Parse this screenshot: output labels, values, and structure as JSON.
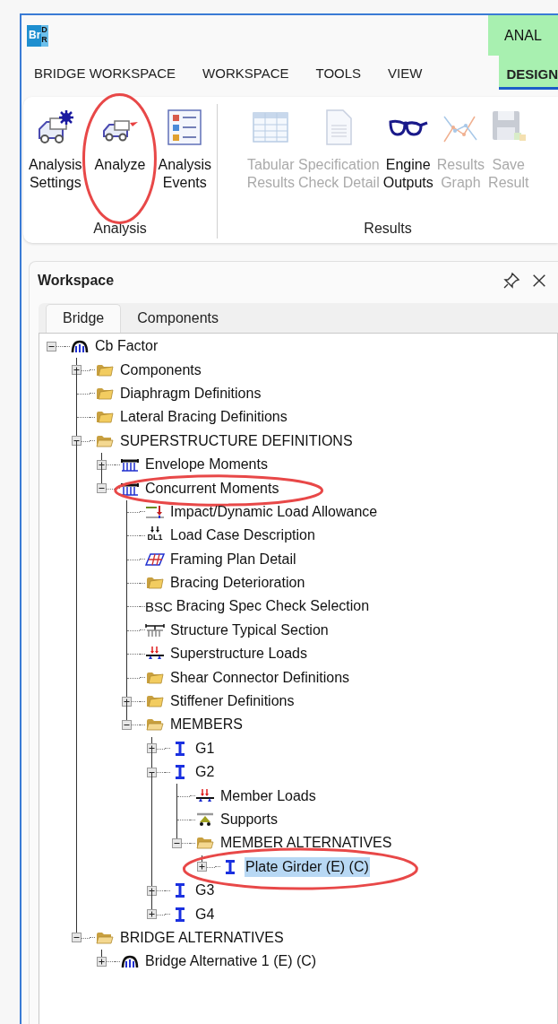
{
  "app": {
    "logo": [
      "Br",
      "DR"
    ],
    "context_tab": "ANAL"
  },
  "menu": [
    {
      "label": "BRIDGE WORKSPACE",
      "selected": false
    },
    {
      "label": "WORKSPACE",
      "selected": false
    },
    {
      "label": "TOOLS",
      "selected": false
    },
    {
      "label": "VIEW",
      "selected": false
    },
    {
      "label": "DESIGN",
      "selected": true
    }
  ],
  "ribbon": [
    {
      "label": "Analysis",
      "buttons": [
        {
          "kind": "settings",
          "lines": [
            "Analysis",
            "Settings"
          ],
          "disabled": false,
          "circled": false
        },
        {
          "kind": "analyze",
          "lines": [
            "Analyze"
          ],
          "disabled": false,
          "circled": true
        },
        {
          "kind": "events",
          "lines": [
            "Analysis",
            "Events"
          ],
          "disabled": false,
          "circled": false
        }
      ]
    },
    {
      "label": "Results",
      "buttons": [
        {
          "kind": "table",
          "lines": [
            "Tabular",
            "Results"
          ],
          "disabled": true,
          "circled": false
        },
        {
          "kind": "document",
          "lines": [
            "Specification",
            "Check Detail"
          ],
          "disabled": true,
          "circled": false
        },
        {
          "kind": "glasses",
          "lines": [
            "Engine",
            "Outputs"
          ],
          "disabled": false,
          "circled": false
        },
        {
          "kind": "graph",
          "lines": [
            "Results",
            "Graph"
          ],
          "disabled": true,
          "circled": false
        },
        {
          "kind": "save",
          "lines": [
            "Save",
            "Result"
          ],
          "disabled": true,
          "circled": false
        }
      ]
    }
  ],
  "workspace": {
    "title": "Workspace",
    "tabs": [
      {
        "label": "Bridge",
        "selected": true
      },
      {
        "label": "Components",
        "selected": false
      }
    ],
    "tree": [
      {
        "label": "Cb Factor",
        "kind": "bridge",
        "expanded": true,
        "selected": false,
        "circled": false,
        "children": [
          {
            "label": "Components",
            "kind": "folder",
            "expanded": false,
            "selected": false,
            "circled": false
          },
          {
            "label": "Diaphragm Definitions",
            "kind": "folder",
            "selected": false,
            "circled": false
          },
          {
            "label": "Lateral Bracing Definitions",
            "kind": "folder",
            "selected": false,
            "circled": false
          },
          {
            "label": "SUPERSTRUCTURE DEFINITIONS",
            "kind": "folder-open",
            "expanded": true,
            "selected": false,
            "circled": false,
            "children": [
              {
                "label": "Envelope Moments",
                "kind": "beam",
                "expanded": false,
                "selected": false,
                "circled": false
              },
              {
                "label": "Concurrent Moments",
                "kind": "beam",
                "expanded": true,
                "selected": false,
                "circled": true,
                "children": [
                  {
                    "label": "Impact/Dynamic Load Allowance",
                    "kind": "impact",
                    "selected": false,
                    "circled": false
                  },
                  {
                    "label": "Load Case Description",
                    "kind": "loadcase",
                    "icon_text": "DL1",
                    "selected": false,
                    "circled": false
                  },
                  {
                    "label": "Framing Plan Detail",
                    "kind": "framing",
                    "selected": false,
                    "circled": false
                  },
                  {
                    "label": "Bracing Deterioration",
                    "kind": "folder",
                    "selected": false,
                    "circled": false
                  },
                  {
                    "label": "Bracing Spec Check Selection",
                    "kind": "text",
                    "icon_text": "BSC",
                    "selected": false,
                    "circled": false
                  },
                  {
                    "label": "Structure Typical Section",
                    "kind": "section",
                    "selected": false,
                    "circled": false
                  },
                  {
                    "label": "Superstructure Loads",
                    "kind": "loads",
                    "selected": false,
                    "circled": false
                  },
                  {
                    "label": "Shear Connector Definitions",
                    "kind": "folder",
                    "selected": false,
                    "circled": false
                  },
                  {
                    "label": "Stiffener Definitions",
                    "kind": "folder",
                    "expanded": false,
                    "selected": false,
                    "circled": false
                  },
                  {
                    "label": "MEMBERS",
                    "kind": "folder-open",
                    "expanded": true,
                    "selected": false,
                    "circled": false,
                    "children": [
                      {
                        "label": "G1",
                        "kind": "girder",
                        "expanded": false,
                        "selected": false,
                        "circled": false
                      },
                      {
                        "label": "G2",
                        "kind": "girder",
                        "expanded": true,
                        "selected": false,
                        "circled": false,
                        "children": [
                          {
                            "label": "Member Loads",
                            "kind": "loads",
                            "selected": false,
                            "circled": false
                          },
                          {
                            "label": "Supports",
                            "kind": "support",
                            "selected": false,
                            "circled": false
                          },
                          {
                            "label": "MEMBER ALTERNATIVES",
                            "kind": "folder-open",
                            "expanded": true,
                            "selected": false,
                            "circled": false,
                            "children": [
                              {
                                "label": "Plate Girder (E)  (C)",
                                "kind": "girder",
                                "expanded": false,
                                "selected": true,
                                "circled": true
                              }
                            ]
                          }
                        ]
                      },
                      {
                        "label": "G3",
                        "kind": "girder",
                        "expanded": false,
                        "selected": false,
                        "circled": false
                      },
                      {
                        "label": "G4",
                        "kind": "girder",
                        "expanded": false,
                        "selected": false,
                        "circled": false
                      }
                    ]
                  }
                ]
              }
            ]
          },
          {
            "label": "BRIDGE ALTERNATIVES",
            "kind": "folder-open",
            "expanded": true,
            "selected": false,
            "circled": false,
            "children": [
              {
                "label": "Bridge Alternative 1 (E)  (C)",
                "kind": "bridge",
                "expanded": false,
                "selected": false,
                "circled": false
              }
            ]
          }
        ]
      }
    ]
  }
}
